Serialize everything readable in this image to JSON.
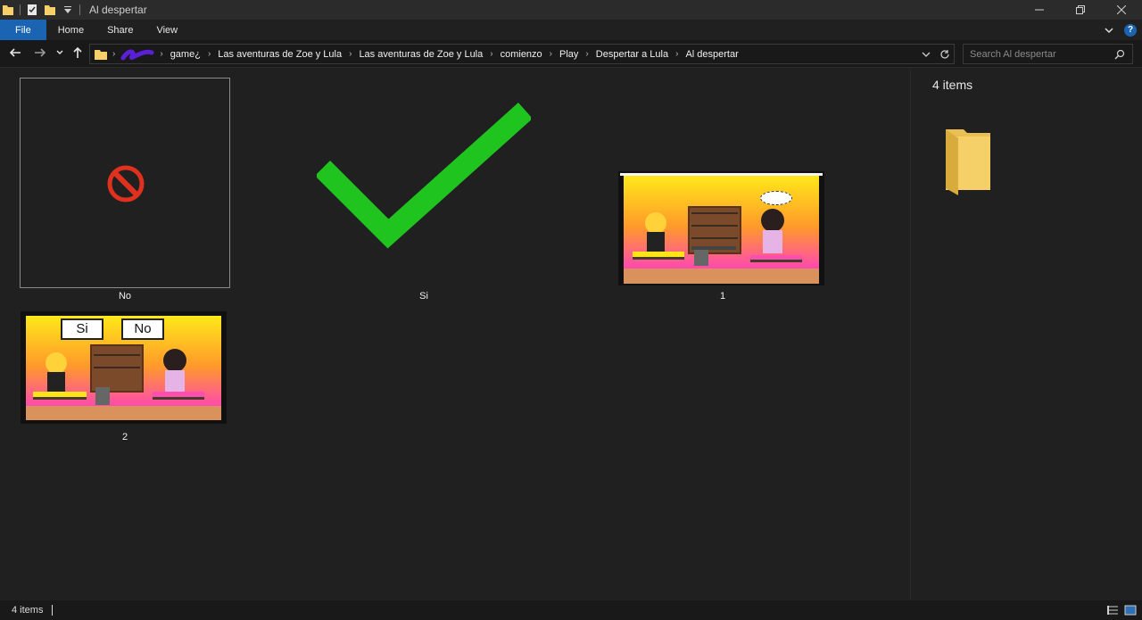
{
  "window": {
    "title": "Al despertar"
  },
  "ribbon": {
    "tabs": [
      "File",
      "Home",
      "Share",
      "View"
    ]
  },
  "breadcrumb": [
    "game¿",
    "Las aventuras de Zoe y Lula",
    "Las aventuras de Zoe y Lula",
    "comienzo",
    "Play",
    "Despertar a Lula",
    "Al despertar"
  ],
  "search": {
    "placeholder": "Search Al despertar"
  },
  "items": [
    {
      "name": "No"
    },
    {
      "name": "Si"
    },
    {
      "name": "1"
    },
    {
      "name": "2",
      "buttons": [
        "Si",
        "No"
      ]
    }
  ],
  "preview": {
    "count": "4 items"
  },
  "status": {
    "text": "4 items"
  },
  "colors": {
    "accent": "#1a64b2",
    "check": "#1fc41f",
    "stop": "#e0301e",
    "folder": "#f5cf67"
  }
}
